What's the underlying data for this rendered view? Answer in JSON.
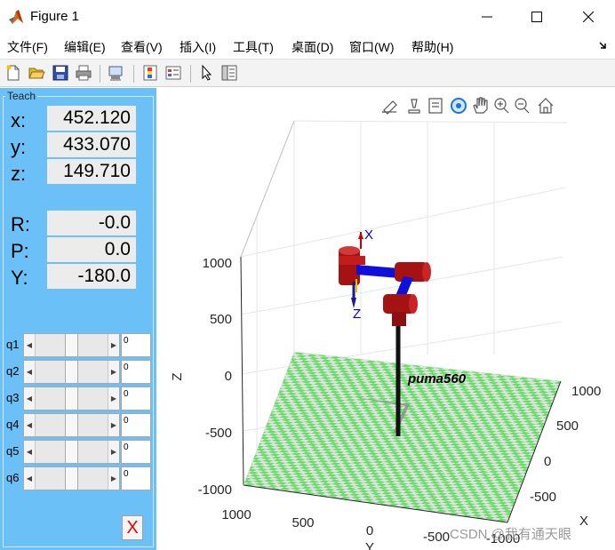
{
  "window": {
    "title": "Figure 1",
    "minimize_glyph": "—",
    "maximize_glyph": "☐",
    "close_glyph": "✕"
  },
  "menu": [
    {
      "label": "文件(F)",
      "x": 8
    },
    {
      "label": "编辑(E)",
      "x": 72
    },
    {
      "label": "查看(V)",
      "x": 136
    },
    {
      "label": "插入(I)",
      "x": 202
    },
    {
      "label": "工具(T)",
      "x": 262
    },
    {
      "label": "桌面(D)",
      "x": 328
    },
    {
      "label": "窗口(W)",
      "x": 393
    },
    {
      "label": "帮助(H)",
      "x": 463
    }
  ],
  "toolbar_icons": [
    "new-figure-icon",
    "open-folder-icon",
    "save-icon",
    "print-icon",
    "link-figure-icon",
    "colorbar-icon",
    "legend-icon",
    "pointer-icon",
    "property-inspector-icon"
  ],
  "axes_toolbar_icons": [
    "brush-icon",
    "data-tips-icon",
    "legend-toggle-icon",
    "rotate-3d-icon",
    "pan-icon",
    "zoom-in-icon",
    "zoom-out-icon",
    "home-icon"
  ],
  "teach": {
    "title": "Teach",
    "position": [
      {
        "label": "x:",
        "value": "452.120"
      },
      {
        "label": "y:",
        "value": "433.070"
      },
      {
        "label": "z:",
        "value": "149.710"
      }
    ],
    "orientation": [
      {
        "label": "R:",
        "value": "-0.0"
      },
      {
        "label": "P:",
        "value": "0.0"
      },
      {
        "label": "Y:",
        "value": "-180.0"
      }
    ],
    "joints": [
      {
        "label": "q1",
        "value": "0"
      },
      {
        "label": "q2",
        "value": "0"
      },
      {
        "label": "q3",
        "value": "0"
      },
      {
        "label": "q4",
        "value": "0"
      },
      {
        "label": "q5",
        "value": "0"
      },
      {
        "label": "q6",
        "value": "0"
      }
    ],
    "close_label": "X"
  },
  "plot": {
    "robot_name": "puma560",
    "z_axis_label": "Z",
    "x_axis_label": "X",
    "y_axis_label": "Y",
    "frame_x_label": "X",
    "frame_z_label": "Z",
    "z_ticks": [
      "1000",
      "500",
      "0",
      "-500",
      "-1000"
    ],
    "x_ticks": [
      "1000",
      "500",
      "0",
      "-500",
      "-1000"
    ],
    "y_ticks": [
      "1000",
      "500",
      "0",
      "-500"
    ],
    "floor_color_a": "#66dd66",
    "floor_color_b": "#e2e2e2",
    "link_red": "#a51212",
    "link_blue": "#1010dd"
  },
  "watermark": "CSDN @我有通天眼"
}
